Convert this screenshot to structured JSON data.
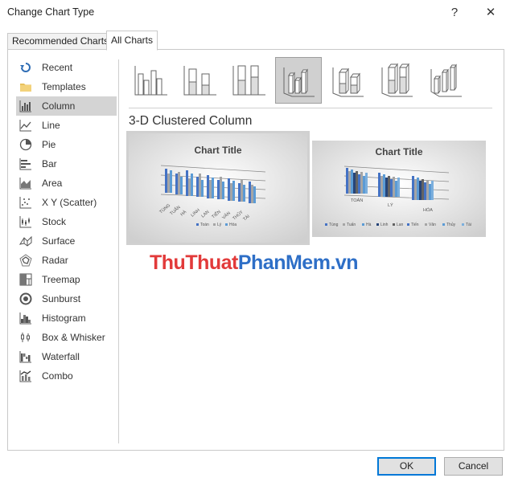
{
  "window": {
    "title": "Change Chart Type",
    "help_label": "?",
    "close_label": "✕"
  },
  "tabs": [
    {
      "label": "Recommended Charts",
      "active": false
    },
    {
      "label": "All Charts",
      "active": true
    }
  ],
  "sidebar": {
    "items": [
      {
        "label": "Recent",
        "icon": "recent-icon"
      },
      {
        "label": "Templates",
        "icon": "folder-icon"
      },
      {
        "label": "Column",
        "icon": "column-chart-icon",
        "selected": true
      },
      {
        "label": "Line",
        "icon": "line-chart-icon"
      },
      {
        "label": "Pie",
        "icon": "pie-chart-icon"
      },
      {
        "label": "Bar",
        "icon": "bar-chart-icon"
      },
      {
        "label": "Area",
        "icon": "area-chart-icon"
      },
      {
        "label": "X Y (Scatter)",
        "icon": "scatter-chart-icon"
      },
      {
        "label": "Stock",
        "icon": "stock-chart-icon"
      },
      {
        "label": "Surface",
        "icon": "surface-chart-icon"
      },
      {
        "label": "Radar",
        "icon": "radar-chart-icon"
      },
      {
        "label": "Treemap",
        "icon": "treemap-chart-icon"
      },
      {
        "label": "Sunburst",
        "icon": "sunburst-chart-icon"
      },
      {
        "label": "Histogram",
        "icon": "histogram-chart-icon"
      },
      {
        "label": "Box & Whisker",
        "icon": "box-whisker-chart-icon"
      },
      {
        "label": "Waterfall",
        "icon": "waterfall-chart-icon"
      },
      {
        "label": "Combo",
        "icon": "combo-chart-icon"
      }
    ]
  },
  "subtypes": [
    {
      "icon": "clustered-column-icon"
    },
    {
      "icon": "stacked-column-icon"
    },
    {
      "icon": "100-stacked-column-icon"
    },
    {
      "icon": "3d-clustered-column-icon",
      "selected": true
    },
    {
      "icon": "3d-stacked-column-icon"
    },
    {
      "icon": "3d-100-stacked-column-icon"
    },
    {
      "icon": "3d-column-icon"
    }
  ],
  "subtype_title": "3-D Clustered Column",
  "previews": [
    {
      "chart_title": "Chart Title",
      "categories": [
        "TÙNG",
        "TUẤN",
        "HÀ",
        "LINH",
        "LAN",
        "TIẾN",
        "VÂN",
        "THỦY",
        "TÀI"
      ],
      "legend": [
        "Toán",
        "Lý",
        "Hóa"
      ],
      "selected": true
    },
    {
      "chart_title": "Chart Title",
      "categories": [
        "TOÁN",
        "LÝ",
        "HÓA"
      ],
      "legend": [
        "Tùng",
        "Tuấn",
        "Hà",
        "Linh",
        "Lan",
        "Tiến",
        "Vân",
        "Thủy",
        "Tài"
      ],
      "selected": false
    }
  ],
  "watermark": {
    "part1": "ThuThuat",
    "part2": "PhanMem.vn"
  },
  "buttons": {
    "ok": "OK",
    "cancel": "Cancel"
  },
  "colors": {
    "accent": "#0078d7",
    "series1": "#4472c4",
    "series2": "#a5a5a5",
    "series3": "#5b9bd5"
  }
}
